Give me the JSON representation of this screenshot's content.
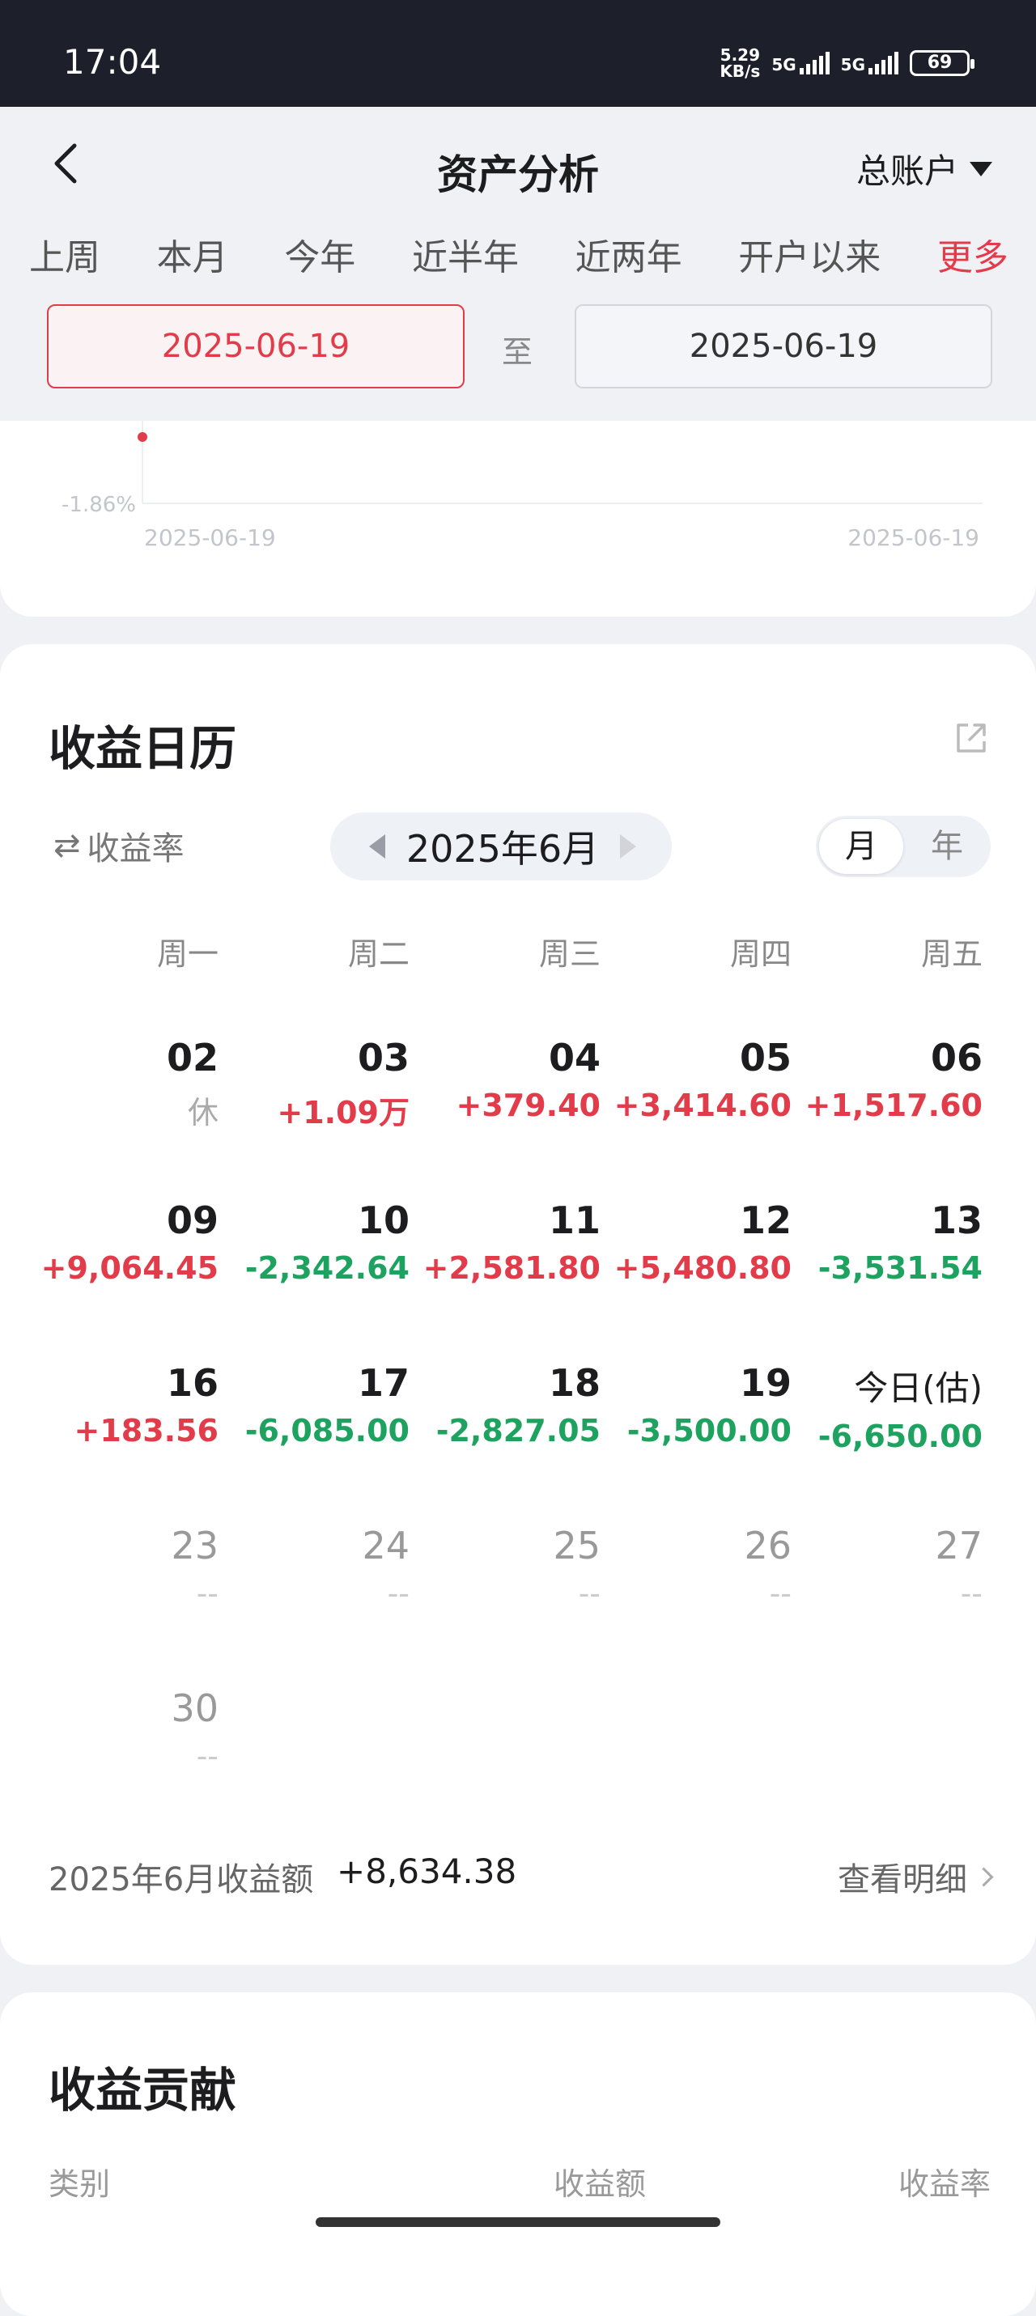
{
  "status": {
    "time": "17:04",
    "speed": "5.29",
    "speed_unit": "KB/s",
    "net1": "5G",
    "net2": "5G",
    "battery": "69"
  },
  "header": {
    "title": "资产分析",
    "account": "总账户"
  },
  "ranges": [
    "上周",
    "本月",
    "今年",
    "近半年",
    "近两年",
    "开户以来",
    "更多"
  ],
  "date_range": {
    "start": "2025-06-19",
    "sep": "至",
    "end": "2025-06-19"
  },
  "chart_data": {
    "type": "line",
    "ytick": "-1.86%",
    "xticks": [
      "2025-06-19",
      "2025-06-19"
    ],
    "x": [
      "2025-06-19"
    ],
    "y": [
      -1.86
    ]
  },
  "calendar": {
    "title": "收益日历",
    "metric_toggle": "收益率",
    "month": "2025年6月",
    "view_month": "月",
    "view_year": "年",
    "weekdays": [
      "周一",
      "周二",
      "周三",
      "周四",
      "周五"
    ],
    "days": [
      {
        "d": "02",
        "v": "休"
      },
      {
        "d": "03",
        "v": "+1.09万"
      },
      {
        "d": "04",
        "v": "+379.40"
      },
      {
        "d": "05",
        "v": "+3,414.60"
      },
      {
        "d": "06",
        "v": "+1,517.60"
      },
      {
        "d": "09",
        "v": "+9,064.45"
      },
      {
        "d": "10",
        "v": "-2,342.64"
      },
      {
        "d": "11",
        "v": "+2,581.80"
      },
      {
        "d": "12",
        "v": "+5,480.80"
      },
      {
        "d": "13",
        "v": "-3,531.54"
      },
      {
        "d": "16",
        "v": "+183.56"
      },
      {
        "d": "17",
        "v": "-6,085.00"
      },
      {
        "d": "18",
        "v": "-2,827.05"
      },
      {
        "d": "19",
        "v": "-3,500.00"
      },
      {
        "d": "今日(估)",
        "v": "-6,650.00"
      },
      {
        "d": "23",
        "v": "--"
      },
      {
        "d": "24",
        "v": "--"
      },
      {
        "d": "25",
        "v": "--"
      },
      {
        "d": "26",
        "v": "--"
      },
      {
        "d": "27",
        "v": "--"
      },
      {
        "d": "30",
        "v": "--"
      }
    ],
    "summary_label": "2025年6月收益额",
    "summary_value": "+8,634.38",
    "detail_link": "查看明细"
  },
  "contribution": {
    "title": "收益贡献",
    "col_category": "类别",
    "col_amount": "收益额",
    "col_rate": "收益率"
  }
}
